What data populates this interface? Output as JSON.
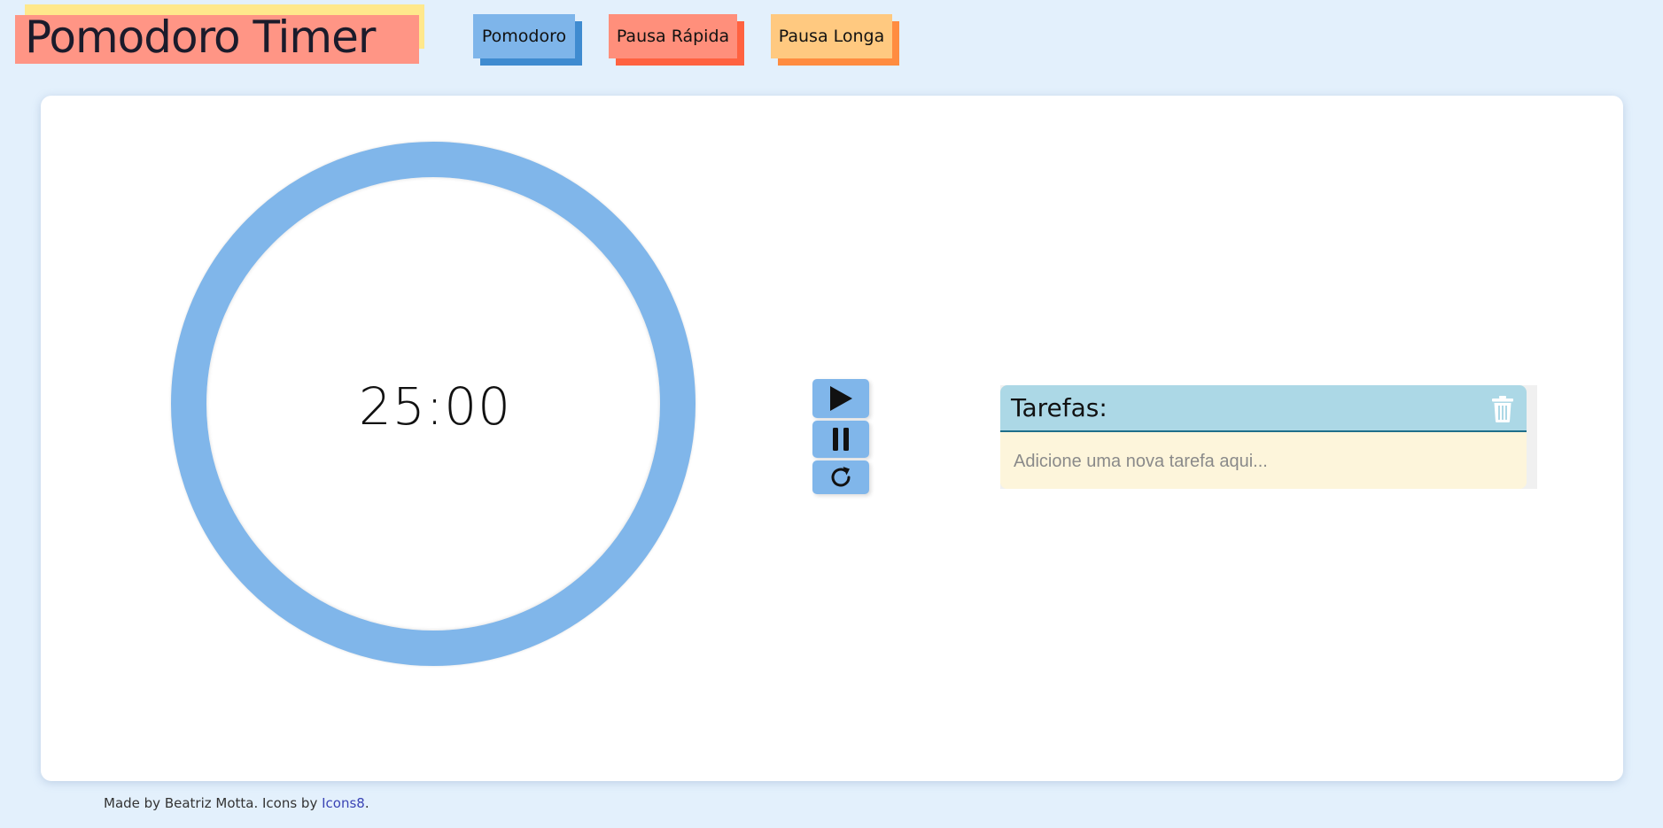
{
  "header": {
    "title": "Pomodoro Timer"
  },
  "modes": {
    "pomodoro_label": "Pomodoro",
    "short_break_label": "Pausa Rápida",
    "long_break_label": "Pausa Longa"
  },
  "timer": {
    "display": "25:00"
  },
  "controls": {
    "play_icon": "play-icon",
    "pause_icon": "pause-icon",
    "reset_icon": "reset-icon"
  },
  "tasks": {
    "title": "Tarefas:",
    "input_placeholder": "Adicione uma nova tarefa aqui...",
    "input_value": "",
    "clear_icon": "trash-icon"
  },
  "footer": {
    "credit_prefix": "Made by Beatriz Motta. Icons by ",
    "link_text": "Icons8",
    "credit_suffix": "."
  },
  "colors": {
    "background": "#e3f0fc",
    "accent_blue": "#80b6ea",
    "accent_salmon": "#ff8f7b",
    "accent_orange": "#ffc980",
    "logo_yellow": "#ffe88c",
    "tasks_header": "#acd8e6",
    "tasks_body": "#fdf5db"
  }
}
